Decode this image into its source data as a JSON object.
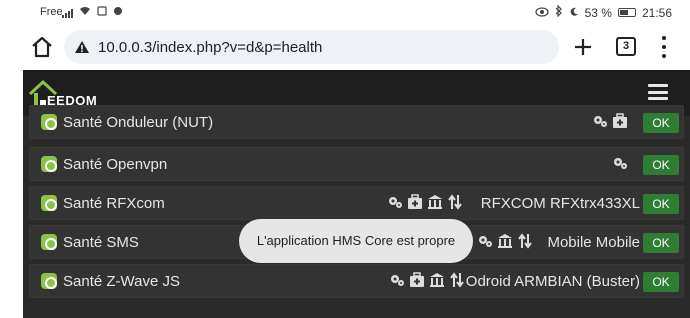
{
  "status_bar": {
    "carrier": "Free",
    "battery": "53 %",
    "time": "21:56"
  },
  "browser": {
    "url": "10.0.0.3/index.php?v=d&p=health",
    "tab_count": "3"
  },
  "app": {
    "logo_text": "EEDOM"
  },
  "health_rows": [
    {
      "name": "Santé Onduleur (NUT)",
      "detail": "",
      "status": "OK"
    },
    {
      "name": "Santé Openvpn",
      "detail": "",
      "status": "OK"
    },
    {
      "name": "Santé RFXcom",
      "detail": "RFXCOM RFXtrx433XL",
      "status": "OK"
    },
    {
      "name": "Santé SMS",
      "detail": "Mobile Mobile",
      "status": "OK"
    },
    {
      "name": "Santé Z-Wave JS",
      "detail": "Odroid ARMBIAN (Buster)",
      "status": "OK"
    }
  ],
  "toast": {
    "message": "L'application HMS Core est propre"
  },
  "colors": {
    "ok_green": "#2e7d32",
    "plugin_green": "#8bc34a",
    "row_bg": "#333333",
    "navbar_bg": "#1e1e1e"
  }
}
